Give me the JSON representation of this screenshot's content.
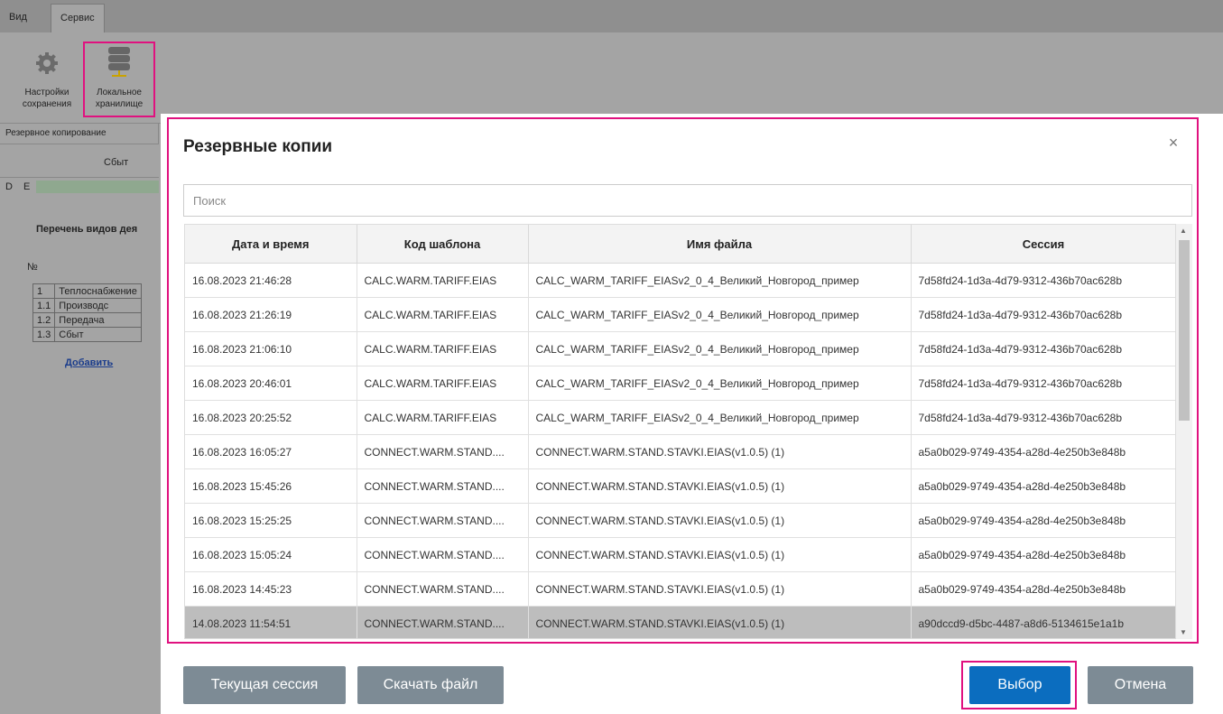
{
  "ribbon": {
    "tabs": [
      "Вид",
      "Сервис"
    ],
    "buttons": [
      {
        "label_line1": "Настройки",
        "label_line2": "сохранения"
      },
      {
        "label_line1": "Локальное",
        "label_line2": "хранилище"
      }
    ],
    "group_label": "Резервное копирование"
  },
  "sheet": {
    "col_header": "Сбыт",
    "col_letters": [
      "D",
      "E"
    ],
    "title": "Перечень видов дея",
    "no_header": "№",
    "rows": [
      {
        "num": "1",
        "text": "Теплоснабжение"
      },
      {
        "num": "1.1",
        "text": "Производс"
      },
      {
        "num": "1.2",
        "text": "Передача"
      },
      {
        "num": "1.3",
        "text": "Сбыт"
      }
    ],
    "add_link": "Добавить"
  },
  "dialog": {
    "title": "Резервные копии",
    "close_symbol": "×",
    "search_placeholder": "Поиск",
    "columns": [
      "Дата и время",
      "Код шаблона",
      "Имя файла",
      "Сессия"
    ],
    "rows": [
      {
        "date": "16.08.2023 21:46:28",
        "code": "CALC.WARM.TARIFF.EIAS",
        "file": "CALC_WARM_TARIFF_EIASv2_0_4_Великий_Новгород_пример",
        "session": "7d58fd24-1d3a-4d79-9312-436b70ac628b"
      },
      {
        "date": "16.08.2023 21:26:19",
        "code": "CALC.WARM.TARIFF.EIAS",
        "file": "CALC_WARM_TARIFF_EIASv2_0_4_Великий_Новгород_пример",
        "session": "7d58fd24-1d3a-4d79-9312-436b70ac628b"
      },
      {
        "date": "16.08.2023 21:06:10",
        "code": "CALC.WARM.TARIFF.EIAS",
        "file": "CALC_WARM_TARIFF_EIASv2_0_4_Великий_Новгород_пример",
        "session": "7d58fd24-1d3a-4d79-9312-436b70ac628b"
      },
      {
        "date": "16.08.2023 20:46:01",
        "code": "CALC.WARM.TARIFF.EIAS",
        "file": "CALC_WARM_TARIFF_EIASv2_0_4_Великий_Новгород_пример",
        "session": "7d58fd24-1d3a-4d79-9312-436b70ac628b"
      },
      {
        "date": "16.08.2023 20:25:52",
        "code": "CALC.WARM.TARIFF.EIAS",
        "file": "CALC_WARM_TARIFF_EIASv2_0_4_Великий_Новгород_пример",
        "session": "7d58fd24-1d3a-4d79-9312-436b70ac628b"
      },
      {
        "date": "16.08.2023 16:05:27",
        "code": "CONNECT.WARM.STAND....",
        "file": "CONNECT.WARM.STAND.STAVKI.EIAS(v1.0.5) (1)",
        "session": "a5a0b029-9749-4354-a28d-4e250b3e848b"
      },
      {
        "date": "16.08.2023 15:45:26",
        "code": "CONNECT.WARM.STAND....",
        "file": "CONNECT.WARM.STAND.STAVKI.EIAS(v1.0.5) (1)",
        "session": "a5a0b029-9749-4354-a28d-4e250b3e848b"
      },
      {
        "date": "16.08.2023 15:25:25",
        "code": "CONNECT.WARM.STAND....",
        "file": "CONNECT.WARM.STAND.STAVKI.EIAS(v1.0.5) (1)",
        "session": "a5a0b029-9749-4354-a28d-4e250b3e848b"
      },
      {
        "date": "16.08.2023 15:05:24",
        "code": "CONNECT.WARM.STAND....",
        "file": "CONNECT.WARM.STAND.STAVKI.EIAS(v1.0.5) (1)",
        "session": "a5a0b029-9749-4354-a28d-4e250b3e848b"
      },
      {
        "date": "16.08.2023 14:45:23",
        "code": "CONNECT.WARM.STAND....",
        "file": "CONNECT.WARM.STAND.STAVKI.EIAS(v1.0.5) (1)",
        "session": "a5a0b029-9749-4354-a28d-4e250b3e848b"
      },
      {
        "date": "14.08.2023 11:54:51",
        "code": "CONNECT.WARM.STAND....",
        "file": "CONNECT.WARM.STAND.STAVKI.EIAS(v1.0.5) (1)",
        "session": "a90dccd9-d5bc-4487-a8d6-5134615e1a1b",
        "selected": true
      }
    ],
    "buttons": {
      "current_session": "Текущая сессия",
      "download_file": "Скачать файл",
      "select": "Выбор",
      "cancel": "Отмена"
    }
  },
  "colors": {
    "highlight": "#e0117f",
    "primary_button": "#0b6dbf",
    "secondary_button": "#7d8b95",
    "selected_row": "#bdbdbd"
  }
}
